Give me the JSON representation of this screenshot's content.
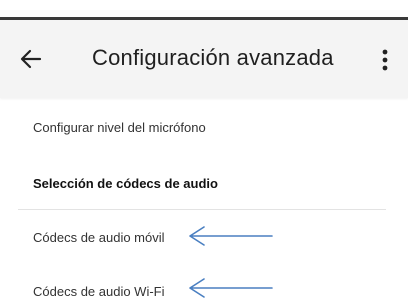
{
  "header": {
    "title": "Configuración avanzada",
    "back_icon": "arrow-left-icon",
    "menu_icon": "more-vert-icon"
  },
  "settings": {
    "mic_level_label": "Configurar nivel del micrófono",
    "codec_section_title": "Selección de códecs de audio",
    "mobile_codecs_label": "Códecs de audio móvil",
    "wifi_codecs_label": "Códecs de audio Wi-Fi"
  },
  "annotations": {
    "arrow_color": "#4a7fc1"
  },
  "colors": {
    "appbar_background": "#f4f4f4",
    "text_primary": "#1f1f1f"
  }
}
